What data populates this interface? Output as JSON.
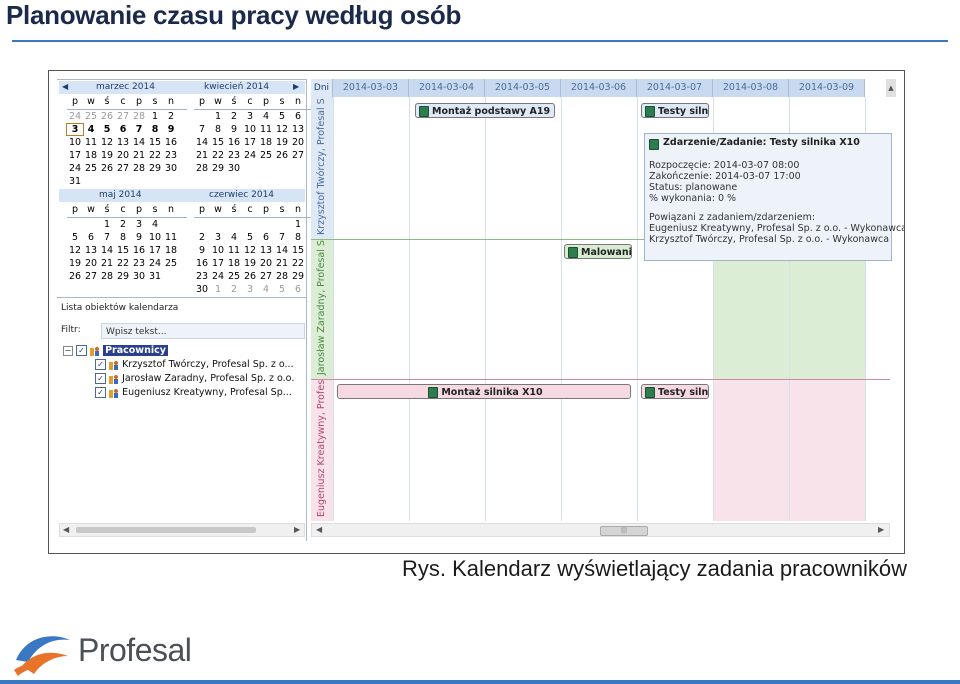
{
  "slide": {
    "title": "Planowanie czasu pracy według osób",
    "caption": "Rys. Kalendarz wyświetlający zadania pracowników",
    "logo_text": "Profesal"
  },
  "calendar": {
    "dow": [
      "p",
      "w",
      "ś",
      "c",
      "p",
      "s",
      "n"
    ],
    "months": [
      {
        "name": "marzec 2014",
        "weeks": [
          [
            "24",
            "25",
            "26",
            "27",
            "28",
            "1",
            "2"
          ],
          [
            "3",
            "4",
            "5",
            "6",
            "7",
            "8",
            "9"
          ],
          [
            "10",
            "11",
            "12",
            "13",
            "14",
            "15",
            "16"
          ],
          [
            "17",
            "18",
            "19",
            "20",
            "21",
            "22",
            "23"
          ],
          [
            "24",
            "25",
            "26",
            "27",
            "28",
            "29",
            "30"
          ],
          [
            "31",
            "",
            "",
            "",
            "",
            "",
            ""
          ]
        ]
      },
      {
        "name": "kwiecień 2014",
        "weeks": [
          [
            "",
            "1",
            "2",
            "3",
            "4",
            "5",
            "6"
          ],
          [
            "7",
            "8",
            "9",
            "10",
            "11",
            "12",
            "13"
          ],
          [
            "14",
            "15",
            "16",
            "17",
            "18",
            "19",
            "20"
          ],
          [
            "21",
            "22",
            "23",
            "24",
            "25",
            "26",
            "27"
          ],
          [
            "28",
            "29",
            "30",
            "",
            "",
            "",
            ""
          ]
        ]
      },
      {
        "name": "maj 2014",
        "weeks": [
          [
            "",
            "",
            "1",
            "2",
            "3",
            "4",
            ""
          ],
          [
            "5",
            "6",
            "7",
            "8",
            "9",
            "10",
            "11"
          ],
          [
            "12",
            "13",
            "14",
            "15",
            "16",
            "17",
            "18"
          ],
          [
            "19",
            "20",
            "21",
            "22",
            "23",
            "24",
            "25"
          ],
          [
            "26",
            "27",
            "28",
            "29",
            "30",
            "31",
            ""
          ]
        ]
      },
      {
        "name": "czerwiec 2014",
        "weeks": [
          [
            "",
            "",
            "",
            "",
            "",
            "",
            "1"
          ],
          [
            "2",
            "3",
            "4",
            "5",
            "6",
            "7",
            "8"
          ],
          [
            "9",
            "10",
            "11",
            "12",
            "13",
            "14",
            "15"
          ],
          [
            "16",
            "17",
            "18",
            "19",
            "20",
            "21",
            "22"
          ],
          [
            "23",
            "24",
            "25",
            "26",
            "27",
            "28",
            "29"
          ],
          [
            "30",
            "1",
            "2",
            "3",
            "4",
            "5",
            "6"
          ]
        ]
      }
    ]
  },
  "objects": {
    "label": "Lista obiektów kalendarza",
    "filter_label": "Filtr:",
    "filter_placeholder": "Wpisz tekst...",
    "group": "Pracownicy",
    "items": [
      "Krzysztof Twórczy, Profesal Sp. z o...",
      "Jarosław Zaradny, Profesal Sp. z o.o.",
      "Eugeniusz Kreatywny, Profesal Sp..."
    ]
  },
  "scheduler": {
    "dni_label": "Dni",
    "dates": [
      "2014-03-03",
      "2014-03-04",
      "2014-03-05",
      "2014-03-06",
      "2014-03-07",
      "2014-03-08",
      "2014-03-09"
    ],
    "people": [
      "Krzysztof Twórczy, Profesal S",
      "Jarosław Zaradny, Profesal Sp",
      "Eugeniusz Kreatywny, Profesa"
    ],
    "tasks": {
      "t1": "Montaż podstawy A19",
      "t2": "Testy silnik",
      "t3": "Malowanie",
      "t4": "Montaż silnika X10",
      "t5": "Testy silnik"
    },
    "popup": {
      "title": "Zdarzenie/Zadanie: Testy silnika X10",
      "start": "Rozpoczęcie: 2014-03-07 08:00",
      "end": "Zakończenie: 2014-03-07 17:00",
      "status": "Status:  planowane",
      "progress": "% wykonania: 0 %",
      "related_label": "Powiązani z zadaniem/zdarzeniem:",
      "related_1": "Eugeniusz Kreatywny, Profesal Sp. z o.o. - Wykonawca",
      "related_2": "Krzysztof Twórczy, Profesal Sp. z o.o. - Wykonawca"
    },
    "scroll_thumb": "|||"
  },
  "colors": {
    "accent": "#3b78c4",
    "row_green": "#dcedd6",
    "row_pink": "#f8e3ea",
    "task_blue": "#dfe9f8",
    "task_green": "#d8ecd2",
    "task_pink": "#f6d9e3"
  }
}
